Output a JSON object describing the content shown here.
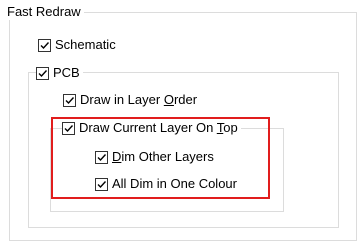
{
  "fast_redraw": {
    "title": "Fast Redraw",
    "schematic": {
      "label": "Schematic",
      "checked": true
    },
    "pcb": {
      "label": "PCB",
      "checked": true,
      "draw_in_layer_order": {
        "prefix": "Draw in Layer ",
        "mnemonic": "O",
        "suffix": "rder",
        "checked": true
      },
      "draw_current_layer_on_top": {
        "prefix": "Draw Current Layer On ",
        "mnemonic": "T",
        "suffix": "op",
        "checked": true,
        "dim_other_layers": {
          "prefix": "",
          "mnemonic": "D",
          "suffix": "im Other Layers",
          "checked": true
        },
        "all_dim_in_one_colour": {
          "label": "All Dim in One Colour",
          "checked": true
        }
      }
    }
  },
  "colors": {
    "highlight": "#e11d1d",
    "group_border": "#dcdcdc"
  }
}
